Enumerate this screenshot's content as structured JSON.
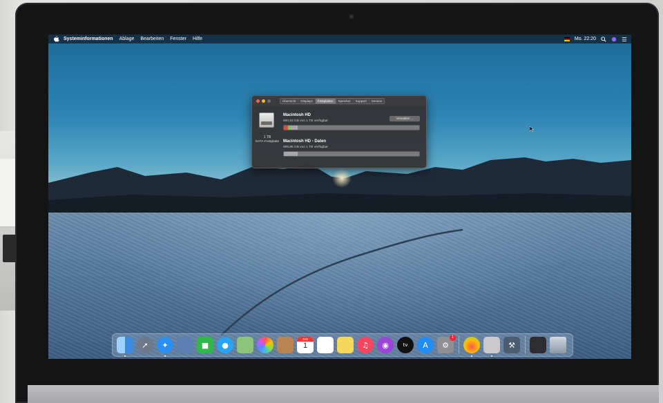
{
  "menubar": {
    "app_name": "Systeminformationen",
    "items": [
      "Ablage",
      "Bearbeiten",
      "Fenster",
      "Hilfe"
    ],
    "clock": "Mo. 22:20"
  },
  "window": {
    "tabs": [
      {
        "label": "Übersicht",
        "active": false
      },
      {
        "label": "Displays",
        "active": false
      },
      {
        "label": "Festplatten",
        "active": true
      },
      {
        "label": "Speicher",
        "active": false
      },
      {
        "label": "Support",
        "active": false
      },
      {
        "label": "Service",
        "active": false
      }
    ],
    "disk": {
      "size": "1 TB",
      "type": "SATA-Festplatte"
    },
    "volumes": [
      {
        "name": "Macintosh HD",
        "free": "900,63 GB von 1 TB verfügbar",
        "used_fraction": 0.1
      },
      {
        "name": "Macintosh HD - Daten",
        "free": "899,85 GB von 1 TB verfügbar",
        "used_fraction": 0.1
      }
    ],
    "manage_label": "Verwalten ..."
  },
  "dock": {
    "apps": [
      {
        "icon": "finder-icon",
        "color": "#3a8be0"
      },
      {
        "icon": "launchpad-icon",
        "color": "#6c7a8a"
      },
      {
        "icon": "safari-icon",
        "color": "#2a8ff0"
      },
      {
        "icon": "preview-icon",
        "color": "#5a7fb0"
      },
      {
        "icon": "facetime-icon",
        "color": "#2fb94a"
      },
      {
        "icon": "messages-icon",
        "color": "#27a4f5"
      },
      {
        "icon": "maps-icon",
        "color": "#8bc57a"
      },
      {
        "icon": "photos-icon",
        "color": "#f7f7f7"
      },
      {
        "icon": "contacts-icon",
        "color": "#b88452"
      },
      {
        "icon": "calendar-icon",
        "color": "#ffffff"
      },
      {
        "icon": "reminders-icon",
        "color": "#ffffff"
      },
      {
        "icon": "notes-icon",
        "color": "#f6d85a"
      },
      {
        "icon": "music-icon",
        "color": "#fb4560"
      },
      {
        "icon": "podcasts-icon",
        "color": "#9b45d8"
      },
      {
        "icon": "appletv-icon",
        "color": "#111111"
      },
      {
        "icon": "appstore-icon",
        "color": "#1f8df3"
      },
      {
        "icon": "system-preferences-icon",
        "color": "#8e8e93"
      },
      {
        "icon": "color-app-icon",
        "color": "#e8e0d0"
      },
      {
        "icon": "printer-utility-icon",
        "color": "#c9c9cc"
      },
      {
        "icon": "xcode-tools-icon",
        "color": "#4a5c70"
      },
      {
        "icon": "downloads-stack-icon",
        "color": "#2d2d2f"
      },
      {
        "icon": "trash-icon",
        "color": "#a9b2bc"
      }
    ],
    "calendar_day": "1",
    "calendar_month": "JAN",
    "sysprefs_badge": "1"
  }
}
